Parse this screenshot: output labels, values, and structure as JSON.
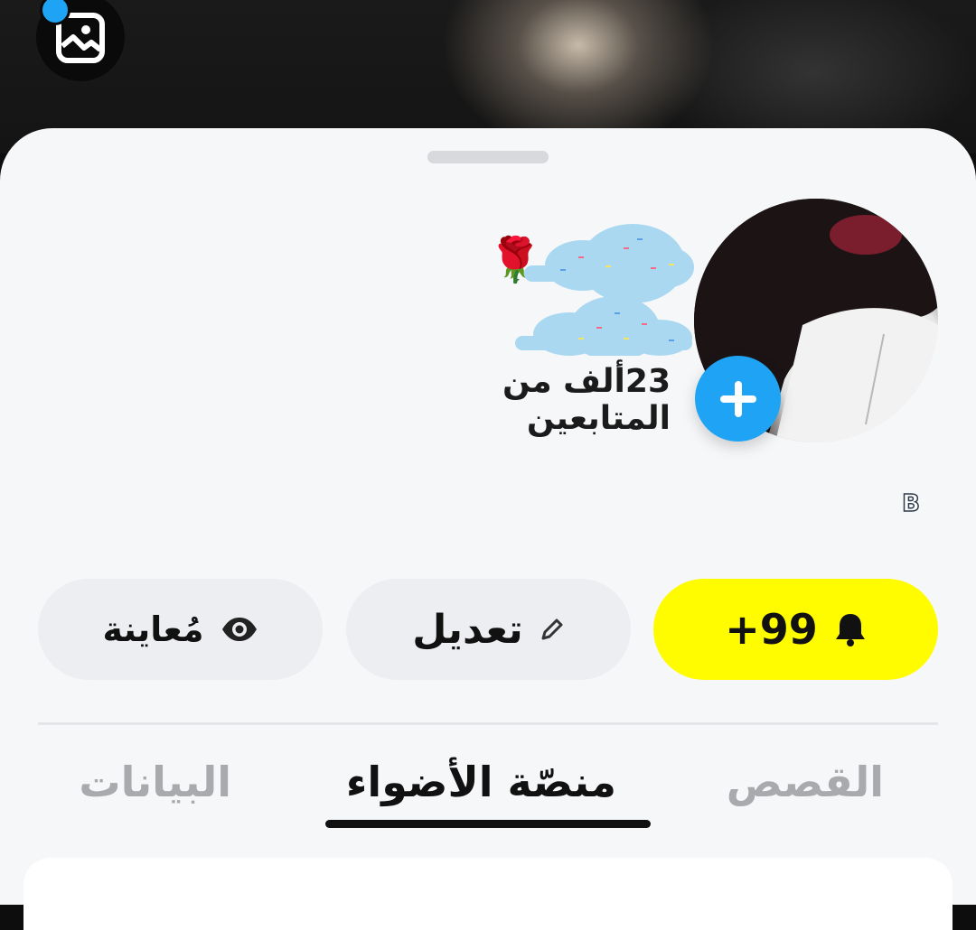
{
  "profile": {
    "followers_text": "23ألف من المتابعين",
    "name_decoration": "🌹",
    "badge_letter": "B"
  },
  "actions": {
    "notifications_label": "+99",
    "edit_label": "تعديل",
    "preview_label": "مُعاينة"
  },
  "tabs": [
    {
      "label": "القصص",
      "active": false
    },
    {
      "label": "منصّة الأضواء",
      "active": true
    },
    {
      "label": "البيانات",
      "active": false
    }
  ],
  "colors": {
    "accent_blue": "#1ea3f5",
    "notification_yellow": "#fffc00",
    "sheet_bg": "#f6f7f9"
  }
}
